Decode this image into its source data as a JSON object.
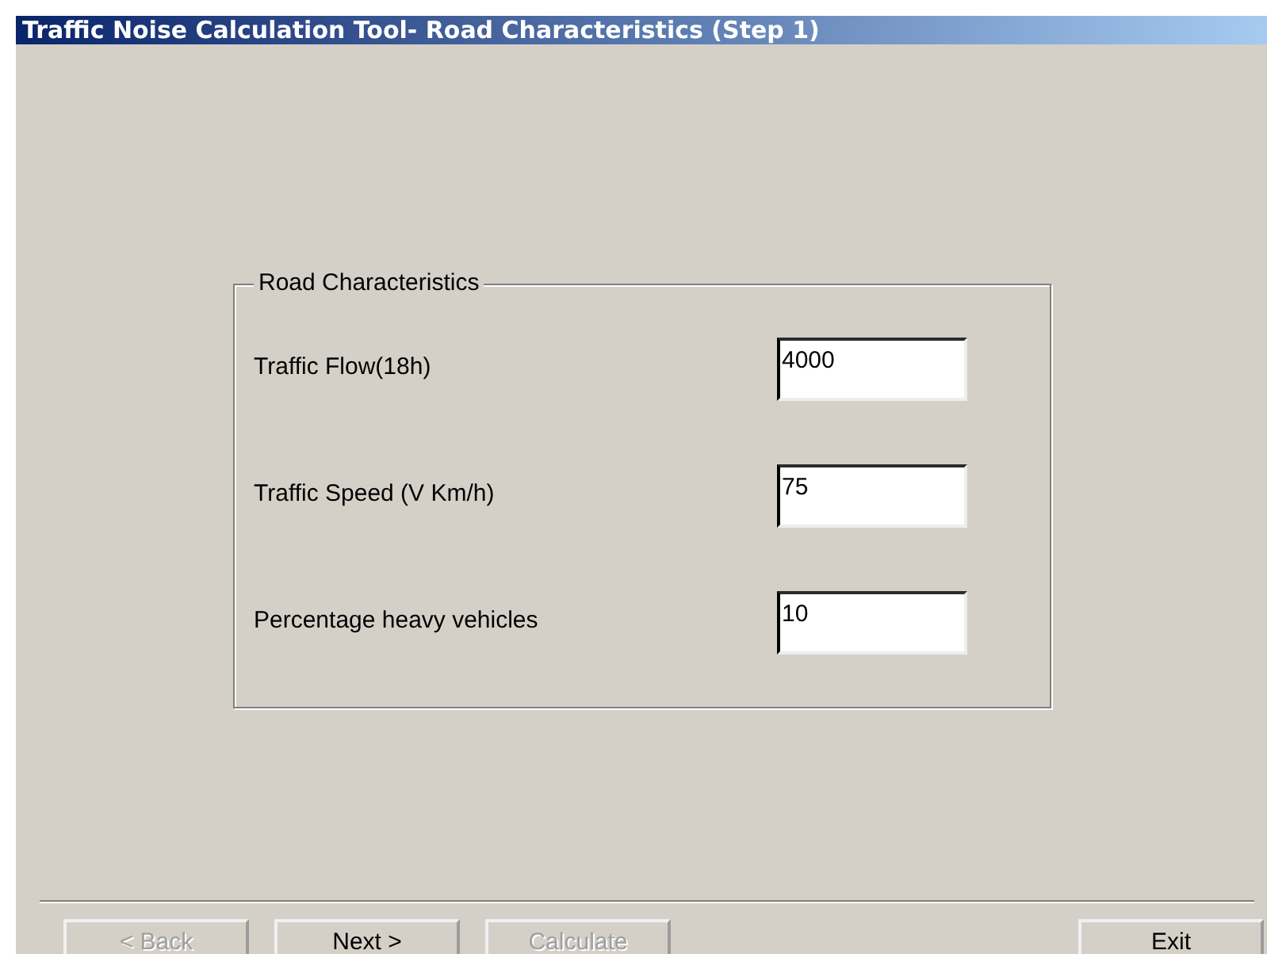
{
  "window": {
    "title": "Traffic Noise Calculation Tool- Road Characteristics (Step 1)"
  },
  "group": {
    "title": "Road Characteristics",
    "fields": [
      {
        "label": "Traffic Flow(18h)",
        "value": "4000"
      },
      {
        "label": "Traffic Speed (V Km/h)",
        "value": "75"
      },
      {
        "label": "Percentage heavy vehicles",
        "value": "10"
      }
    ]
  },
  "buttons": [
    {
      "label": "< Back",
      "disabled": true
    },
    {
      "label": "Next >",
      "disabled": false
    },
    {
      "label": "Calculate",
      "disabled": true
    },
    {
      "label": "Exit",
      "disabled": false
    }
  ]
}
